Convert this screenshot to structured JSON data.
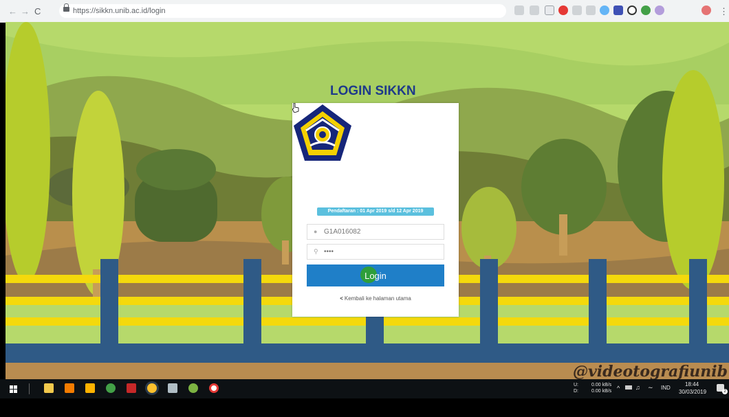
{
  "browser": {
    "url": "https://sikkn.unib.ac.id/login",
    "nav_back": "←",
    "nav_forward": "→",
    "nav_reload": "C",
    "menu_glyph": "⋮"
  },
  "login": {
    "title": "LOGIN SIKKN",
    "registration_badge": "Pendaftaran : 01 Apr 2019 s/d 12 Apr 2019",
    "username_value": "G1A016082",
    "password_value": "••••",
    "login_button": "Login",
    "back_link": "Kembali ke halaman utama"
  },
  "watermark": "@videotografiunib",
  "taskbar": {
    "upload_label": "U:",
    "download_label": "D:",
    "upload_speed": "0.00 kB/s",
    "download_speed": "0.00 kB/s",
    "language": "IND",
    "time": "18:44",
    "date": "30/03/2019",
    "notification_count": "2"
  },
  "colors": {
    "accent": "#1f7fc8",
    "title": "#1e3a8a",
    "badge": "#5bc0de",
    "fence_rail": "#f4d90c",
    "fence_post": "#2f5a86"
  }
}
